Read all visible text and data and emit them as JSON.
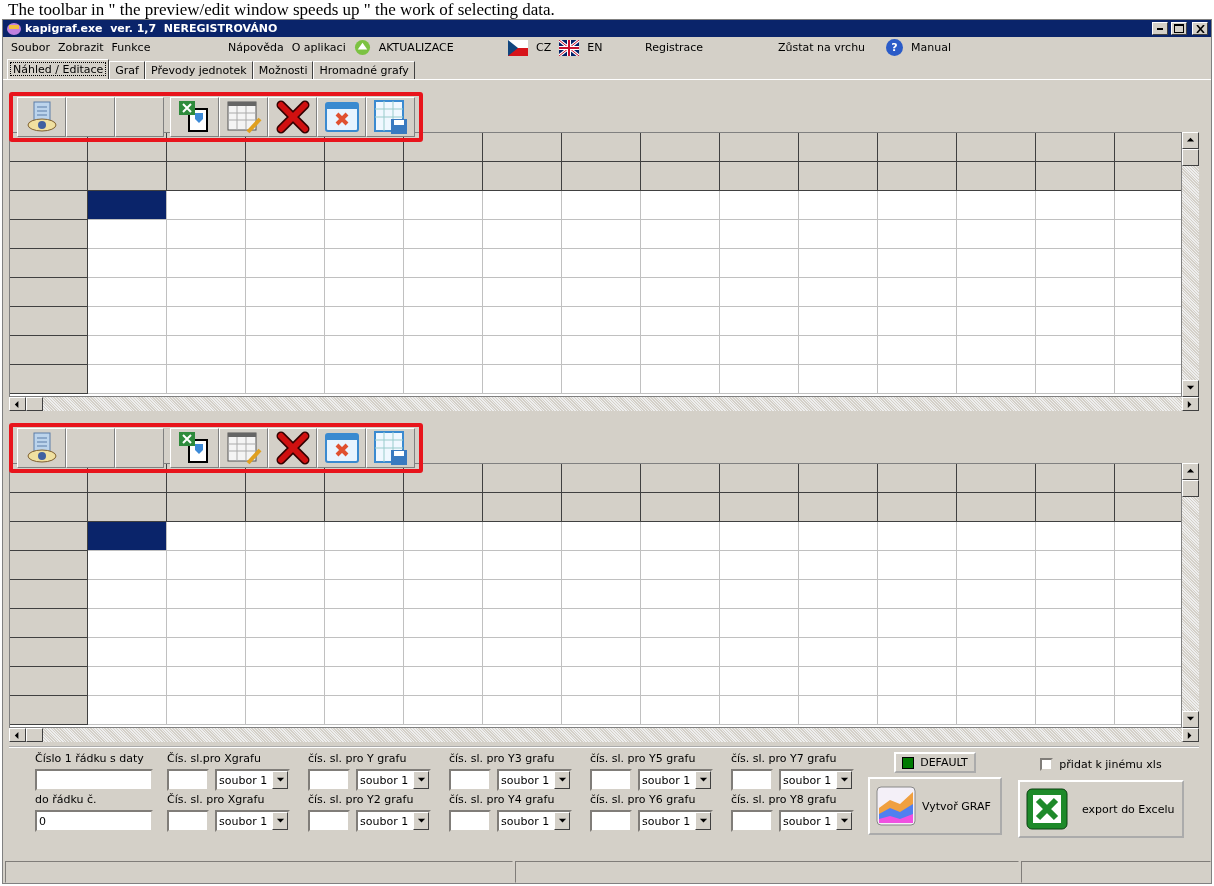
{
  "caption": "The toolbar in \" the preview/edit window speeds up \" the work of selecting data.",
  "window": {
    "title": "kapigraf.exe  ver. 1,7  NEREGISTROVÁNO"
  },
  "menu": [
    {
      "items": [
        {
          "kind": "plain",
          "label": "Soubor"
        },
        {
          "kind": "plain",
          "label": "Zobrazit"
        },
        {
          "kind": "plain",
          "label": "Funkce"
        }
      ]
    },
    {
      "items": [
        {
          "kind": "plain",
          "label": "Nápověda"
        },
        {
          "kind": "plain",
          "label": "O aplikaci"
        },
        {
          "kind": "update",
          "label": "AKTUALIZACE"
        }
      ]
    },
    {
      "items": [
        {
          "kind": "flag_cz",
          "label": "CZ"
        },
        {
          "kind": "flag_en",
          "label": "EN"
        }
      ]
    },
    {
      "items": [
        {
          "kind": "plain",
          "label": "Registrace"
        }
      ]
    },
    {
      "items": [
        {
          "kind": "plain",
          "label": "Zůstat na vrchu"
        }
      ]
    },
    {
      "items": [
        {
          "kind": "help",
          "icon": "?",
          "label": "Manual"
        }
      ]
    }
  ],
  "tabs": [
    {
      "label": "Náhled / Editace",
      "selected": true
    },
    {
      "label": "Graf",
      "selected": false
    },
    {
      "label": "Převody jednotek",
      "selected": false
    },
    {
      "label": "Možnosti",
      "selected": false
    },
    {
      "label": "Hromadné grafy",
      "selected": false
    }
  ],
  "panes": [
    {
      "toolbar": [
        {
          "kind": "preview"
        },
        {
          "kind": "blank"
        },
        {
          "kind": "blank"
        },
        {
          "kind": "excel_import"
        },
        {
          "kind": "edit_table"
        },
        {
          "kind": "delete"
        },
        {
          "kind": "clear_table"
        },
        {
          "kind": "save_table"
        }
      ],
      "rows": [
        {
          "cells": [
            {
              "selected": true
            },
            {
              "selected": false
            },
            {
              "selected": false
            },
            {
              "selected": false
            },
            {
              "selected": false
            },
            {
              "selected": false
            },
            {
              "selected": false
            },
            {
              "selected": false
            },
            {
              "selected": false
            },
            {
              "selected": false
            },
            {
              "selected": false
            },
            {
              "selected": false
            },
            {
              "selected": false
            },
            {
              "selected": false
            }
          ]
        },
        {
          "cells": [
            {
              "selected": false
            },
            {
              "selected": false
            },
            {
              "selected": false
            },
            {
              "selected": false
            },
            {
              "selected": false
            },
            {
              "selected": false
            },
            {
              "selected": false
            },
            {
              "selected": false
            },
            {
              "selected": false
            },
            {
              "selected": false
            },
            {
              "selected": false
            },
            {
              "selected": false
            },
            {
              "selected": false
            },
            {
              "selected": false
            }
          ]
        },
        {
          "cells": [
            {
              "selected": false
            },
            {
              "selected": false
            },
            {
              "selected": false
            },
            {
              "selected": false
            },
            {
              "selected": false
            },
            {
              "selected": false
            },
            {
              "selected": false
            },
            {
              "selected": false
            },
            {
              "selected": false
            },
            {
              "selected": false
            },
            {
              "selected": false
            },
            {
              "selected": false
            },
            {
              "selected": false
            },
            {
              "selected": false
            }
          ]
        },
        {
          "cells": [
            {
              "selected": false
            },
            {
              "selected": false
            },
            {
              "selected": false
            },
            {
              "selected": false
            },
            {
              "selected": false
            },
            {
              "selected": false
            },
            {
              "selected": false
            },
            {
              "selected": false
            },
            {
              "selected": false
            },
            {
              "selected": false
            },
            {
              "selected": false
            },
            {
              "selected": false
            },
            {
              "selected": false
            },
            {
              "selected": false
            }
          ]
        },
        {
          "cells": [
            {
              "selected": false
            },
            {
              "selected": false
            },
            {
              "selected": false
            },
            {
              "selected": false
            },
            {
              "selected": false
            },
            {
              "selected": false
            },
            {
              "selected": false
            },
            {
              "selected": false
            },
            {
              "selected": false
            },
            {
              "selected": false
            },
            {
              "selected": false
            },
            {
              "selected": false
            },
            {
              "selected": false
            },
            {
              "selected": false
            }
          ]
        },
        {
          "cells": [
            {
              "selected": false
            },
            {
              "selected": false
            },
            {
              "selected": false
            },
            {
              "selected": false
            },
            {
              "selected": false
            },
            {
              "selected": false
            },
            {
              "selected": false
            },
            {
              "selected": false
            },
            {
              "selected": false
            },
            {
              "selected": false
            },
            {
              "selected": false
            },
            {
              "selected": false
            },
            {
              "selected": false
            },
            {
              "selected": false
            }
          ]
        },
        {
          "cells": [
            {
              "selected": false
            },
            {
              "selected": false
            },
            {
              "selected": false
            },
            {
              "selected": false
            },
            {
              "selected": false
            },
            {
              "selected": false
            },
            {
              "selected": false
            },
            {
              "selected": false
            },
            {
              "selected": false
            },
            {
              "selected": false
            },
            {
              "selected": false
            },
            {
              "selected": false
            },
            {
              "selected": false
            },
            {
              "selected": false
            }
          ]
        }
      ]
    },
    {
      "toolbar": [
        {
          "kind": "preview"
        },
        {
          "kind": "blank"
        },
        {
          "kind": "blank"
        },
        {
          "kind": "excel_import"
        },
        {
          "kind": "edit_table"
        },
        {
          "kind": "delete"
        },
        {
          "kind": "clear_table"
        },
        {
          "kind": "save_table"
        }
      ],
      "rows": [
        {
          "cells": [
            {
              "selected": true
            },
            {
              "selected": false
            },
            {
              "selected": false
            },
            {
              "selected": false
            },
            {
              "selected": false
            },
            {
              "selected": false
            },
            {
              "selected": false
            },
            {
              "selected": false
            },
            {
              "selected": false
            },
            {
              "selected": false
            },
            {
              "selected": false
            },
            {
              "selected": false
            },
            {
              "selected": false
            },
            {
              "selected": false
            }
          ]
        },
        {
          "cells": [
            {
              "selected": false
            },
            {
              "selected": false
            },
            {
              "selected": false
            },
            {
              "selected": false
            },
            {
              "selected": false
            },
            {
              "selected": false
            },
            {
              "selected": false
            },
            {
              "selected": false
            },
            {
              "selected": false
            },
            {
              "selected": false
            },
            {
              "selected": false
            },
            {
              "selected": false
            },
            {
              "selected": false
            },
            {
              "selected": false
            }
          ]
        },
        {
          "cells": [
            {
              "selected": false
            },
            {
              "selected": false
            },
            {
              "selected": false
            },
            {
              "selected": false
            },
            {
              "selected": false
            },
            {
              "selected": false
            },
            {
              "selected": false
            },
            {
              "selected": false
            },
            {
              "selected": false
            },
            {
              "selected": false
            },
            {
              "selected": false
            },
            {
              "selected": false
            },
            {
              "selected": false
            },
            {
              "selected": false
            }
          ]
        },
        {
          "cells": [
            {
              "selected": false
            },
            {
              "selected": false
            },
            {
              "selected": false
            },
            {
              "selected": false
            },
            {
              "selected": false
            },
            {
              "selected": false
            },
            {
              "selected": false
            },
            {
              "selected": false
            },
            {
              "selected": false
            },
            {
              "selected": false
            },
            {
              "selected": false
            },
            {
              "selected": false
            },
            {
              "selected": false
            },
            {
              "selected": false
            }
          ]
        },
        {
          "cells": [
            {
              "selected": false
            },
            {
              "selected": false
            },
            {
              "selected": false
            },
            {
              "selected": false
            },
            {
              "selected": false
            },
            {
              "selected": false
            },
            {
              "selected": false
            },
            {
              "selected": false
            },
            {
              "selected": false
            },
            {
              "selected": false
            },
            {
              "selected": false
            },
            {
              "selected": false
            },
            {
              "selected": false
            },
            {
              "selected": false
            }
          ]
        },
        {
          "cells": [
            {
              "selected": false
            },
            {
              "selected": false
            },
            {
              "selected": false
            },
            {
              "selected": false
            },
            {
              "selected": false
            },
            {
              "selected": false
            },
            {
              "selected": false
            },
            {
              "selected": false
            },
            {
              "selected": false
            },
            {
              "selected": false
            },
            {
              "selected": false
            },
            {
              "selected": false
            },
            {
              "selected": false
            },
            {
              "selected": false
            }
          ]
        },
        {
          "cells": [
            {
              "selected": false
            },
            {
              "selected": false
            },
            {
              "selected": false
            },
            {
              "selected": false
            },
            {
              "selected": false
            },
            {
              "selected": false
            },
            {
              "selected": false
            },
            {
              "selected": false
            },
            {
              "selected": false
            },
            {
              "selected": false
            },
            {
              "selected": false
            },
            {
              "selected": false
            },
            {
              "selected": false
            },
            {
              "selected": false
            }
          ]
        }
      ]
    }
  ],
  "range": {
    "first": {
      "label": "Číslo 1 řádku s daty"
    },
    "last": {
      "label": "do řádku č.",
      "value": "0"
    }
  },
  "columns": [
    [
      {
        "label": "Čís. sl.pro Xgrafu",
        "file": "soubor 1"
      },
      {
        "label": "Čís. sl. pro Xgrafu",
        "file": "soubor 1"
      }
    ],
    [
      {
        "label": "čís. sl. pro Y grafu",
        "file": "soubor 1"
      },
      {
        "label": "čís. sl. pro Y2 grafu",
        "file": "soubor 1"
      }
    ],
    [
      {
        "label": "čís. sl. pro Y3 grafu",
        "file": "soubor 1"
      },
      {
        "label": "čís. sl. pro Y4 grafu",
        "file": "soubor 1"
      }
    ],
    [
      {
        "label": "čís. sl. pro Y5 grafu",
        "file": "soubor 1"
      },
      {
        "label": "čís. sl. pro Y6 grafu",
        "file": "soubor 1"
      }
    ],
    [
      {
        "label": "čís. sl. pro Y7 grafu",
        "file": "soubor 1"
      },
      {
        "label": "čís. sl. pro Y8 grafu",
        "file": "soubor 1"
      }
    ]
  ],
  "default_button": {
    "label": "DEFAULT",
    "on": true
  },
  "create_button": {
    "label": "Vytvoř GRAF"
  },
  "append_checkbox": {
    "label": "přidat k jinému xls",
    "checked": false
  },
  "export_button": {
    "label": "export do Excelu"
  }
}
